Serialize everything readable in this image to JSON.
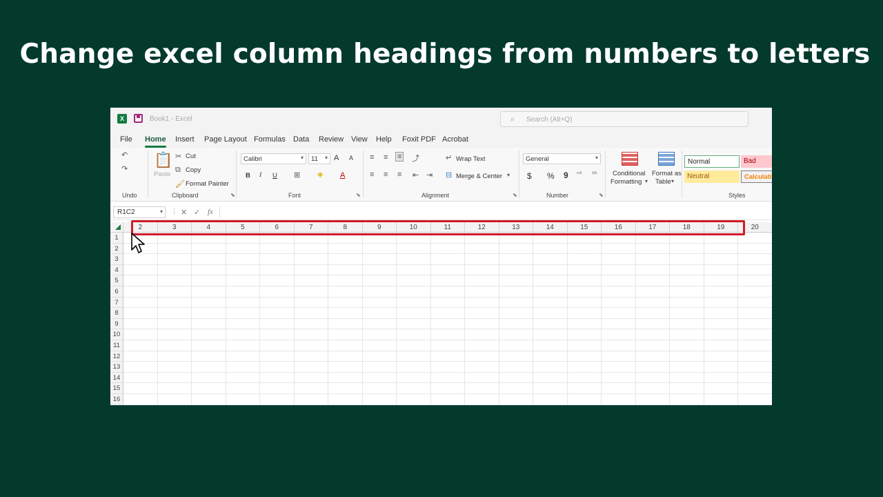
{
  "headline": "Change excel column headings from numbers to letters",
  "window": {
    "title": "Book1 - Excel",
    "logo_letter": "X"
  },
  "search": {
    "placeholder": "Search (Alt+Q)"
  },
  "menu": {
    "tabs": [
      "File",
      "Home",
      "Insert",
      "Page Layout",
      "Formulas",
      "Data",
      "Review",
      "View",
      "Help",
      "Foxit PDF",
      "Acrobat"
    ],
    "active": "Home"
  },
  "ribbon": {
    "undo": {
      "label": "Undo"
    },
    "clipboard": {
      "label": "Clipboard",
      "paste": "Paste",
      "cut": "Cut",
      "copy": "Copy",
      "format_painter": "Format Painter"
    },
    "font": {
      "label": "Font",
      "name": "Calibri",
      "size": "11",
      "grow": "A",
      "shrink": "A",
      "bold": "B",
      "italic": "I",
      "underline": "U",
      "font_color": "A"
    },
    "alignment": {
      "label": "Alignment",
      "wrap_text": "Wrap Text",
      "merge_center": "Merge & Center"
    },
    "number": {
      "label": "Number",
      "format": "General",
      "currency": "$",
      "percent": "%",
      "comma": "9"
    },
    "styles": {
      "label": "Styles",
      "conditional_1": "Conditional",
      "conditional_2": "Formatting",
      "format_table_1": "Format as",
      "format_table_2": "Table",
      "normal": "Normal",
      "bad": "Bad",
      "neutral": "Neutral",
      "calculation": "Calculatio"
    }
  },
  "formula_bar": {
    "name_box": "R1C2",
    "fx": "fx"
  },
  "grid": {
    "column_headers": [
      "2",
      "3",
      "4",
      "5",
      "6",
      "7",
      "8",
      "9",
      "10",
      "11",
      "12",
      "13",
      "14",
      "15",
      "16",
      "17",
      "18",
      "19",
      "20"
    ],
    "row_headers": [
      "1",
      "2",
      "3",
      "4",
      "5",
      "6",
      "7",
      "8",
      "9",
      "10",
      "11",
      "12",
      "13",
      "14",
      "15",
      "16"
    ]
  },
  "colors": {
    "background": "#033a2c",
    "excel_green": "#107c41",
    "highlight": "#d11a2a"
  }
}
